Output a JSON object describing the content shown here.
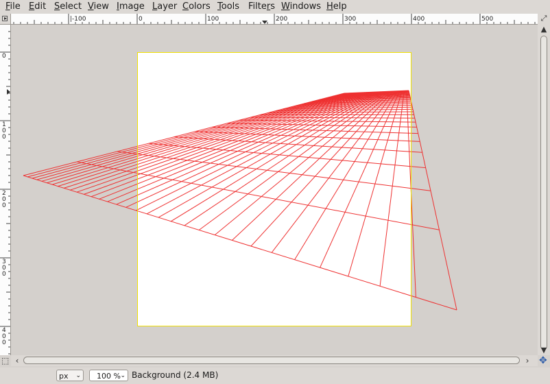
{
  "menubar": {
    "items": [
      {
        "pre": "",
        "u": "F",
        "post": "ile"
      },
      {
        "pre": "",
        "u": "E",
        "post": "dit"
      },
      {
        "pre": "",
        "u": "S",
        "post": "elect"
      },
      {
        "pre": "",
        "u": "V",
        "post": "iew"
      },
      {
        "pre": "",
        "u": "I",
        "post": "mage"
      },
      {
        "pre": "",
        "u": "L",
        "post": "ayer"
      },
      {
        "pre": "",
        "u": "C",
        "post": "olors"
      },
      {
        "pre": "",
        "u": "T",
        "post": "ools"
      },
      {
        "pre": "Filte",
        "u": "r",
        "post": "s"
      },
      {
        "pre": "",
        "u": "W",
        "post": "indows"
      },
      {
        "pre": "",
        "u": "H",
        "post": "elp"
      }
    ]
  },
  "rulers": {
    "horizontal": [
      "|-100",
      "0",
      "100",
      "200",
      "300",
      "400",
      "500"
    ],
    "vertical": [
      "0",
      "100",
      "200",
      "300",
      "400"
    ]
  },
  "status": {
    "unit": "px",
    "zoom": "100 %",
    "layer": "Background (2.4 MB)"
  },
  "canvas": {
    "image_background": "#ffffff",
    "grid_color": "#ee3030"
  },
  "icons": {
    "ruler_corner": "quick-mask-icon",
    "navigate": "navigate-icon",
    "zoom_window": "zoom-to-window-icon",
    "quick_mask": "quick-mask-toggle-icon"
  }
}
